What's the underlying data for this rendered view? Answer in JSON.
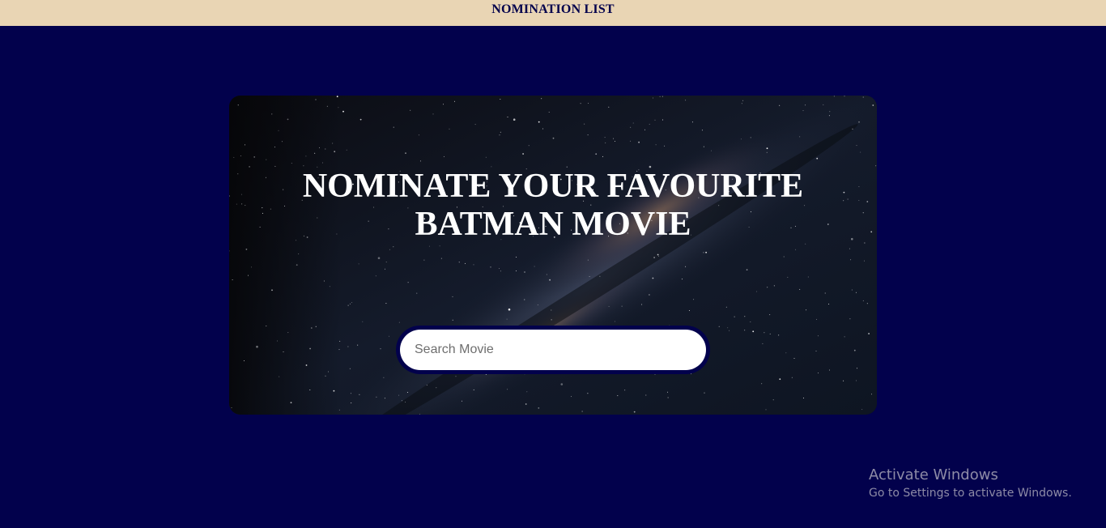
{
  "nav": {
    "link_label": "NOMINATION LIST"
  },
  "hero": {
    "title_line1": "NOMINATE YOUR FAVOURITE",
    "title_line2": "BATMAN MOVIE",
    "search_placeholder": "Search Movie",
    "search_value": ""
  },
  "watermark": {
    "title": "Activate Windows",
    "subtitle": "Go to Settings to activate Windows."
  },
  "colors": {
    "page_background": "#02014c",
    "topbar_background": "#e9d5b4",
    "nav_text": "#02014c",
    "hero_title": "#ffffff",
    "search_border": "#02014c"
  }
}
